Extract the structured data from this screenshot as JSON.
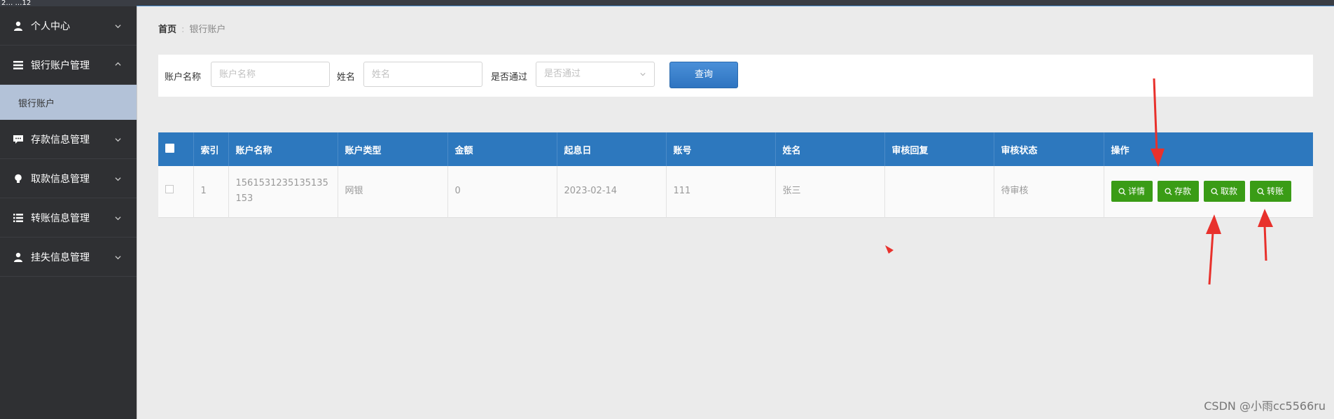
{
  "topbar": {
    "fragment": "2…  …12"
  },
  "sidebar": {
    "items": [
      {
        "label": "个人中心",
        "icon": "user-icon"
      },
      {
        "label": "银行账户管理",
        "icon": "list-icon",
        "expanded": true,
        "sub": [
          "银行账户"
        ]
      },
      {
        "label": "存款信息管理",
        "icon": "comment-icon"
      },
      {
        "label": "取款信息管理",
        "icon": "bulb-icon"
      },
      {
        "label": "转账信息管理",
        "icon": "list-icon"
      },
      {
        "label": "挂失信息管理",
        "icon": "user-icon"
      }
    ]
  },
  "breadcrumb": {
    "home": "首页",
    "separator": ":",
    "current": "银行账户"
  },
  "search": {
    "account_name_label": "账户名称",
    "account_name_placeholder": "账户名称",
    "name_label": "姓名",
    "name_placeholder": "姓名",
    "passed_label": "是否通过",
    "passed_placeholder": "是否通过",
    "query_button": "查询"
  },
  "table": {
    "headers": [
      "索引",
      "账户名称",
      "账户类型",
      "金额",
      "起息日",
      "账号",
      "姓名",
      "审核回复",
      "审核状态",
      "操作"
    ],
    "rows": [
      {
        "index": "1",
        "account_name": "1561531235135135153",
        "account_type": "网银",
        "amount": "0",
        "start_date": "2023-02-14",
        "account_no": "111",
        "name": "张三",
        "review_reply": "",
        "review_status": "待审核",
        "actions": [
          "详情",
          "存款",
          "取款",
          "转账"
        ]
      }
    ]
  },
  "colors": {
    "sidebar_bg": "#2f3033",
    "active_sub_bg": "#b3c2d8",
    "table_header": "#2d78be",
    "query_button": "#2e74c0",
    "action_button": "#3a9c16",
    "annotation_arrow": "#e8312c"
  },
  "watermark": "CSDN @小雨cc5566ru"
}
